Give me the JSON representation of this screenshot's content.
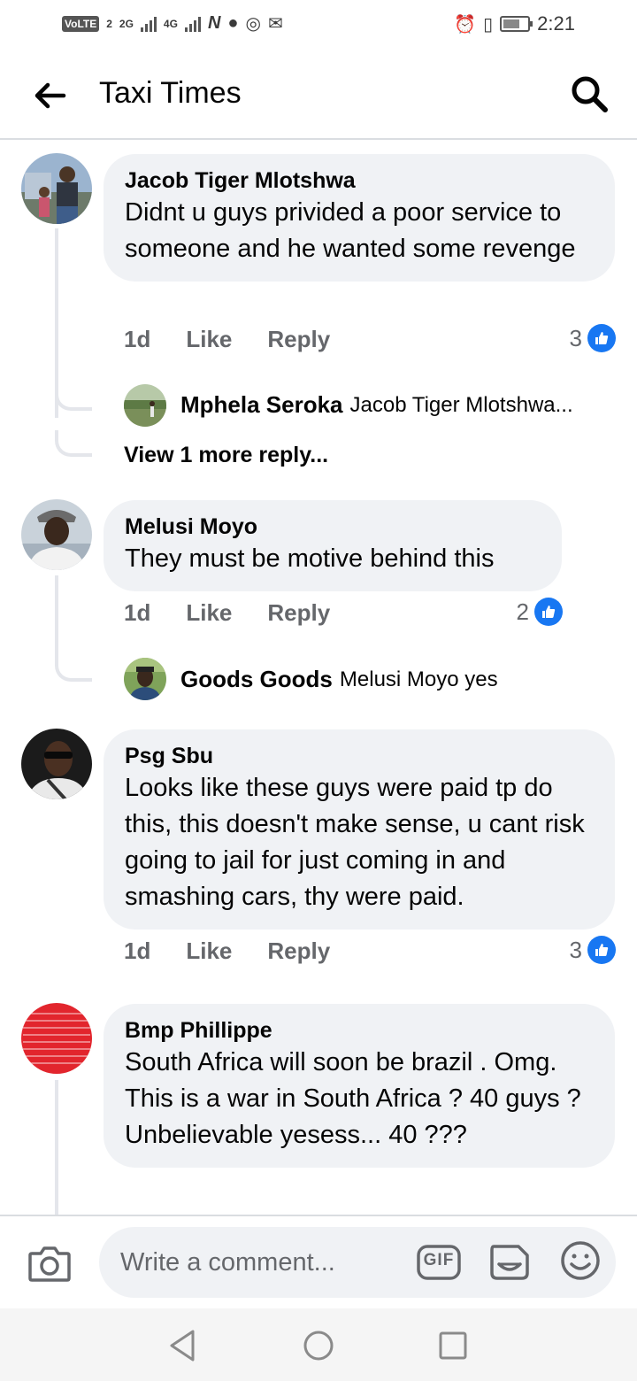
{
  "status_bar": {
    "network_badge": "VoLTE",
    "sim_number": "2",
    "sig1_label": "2G",
    "sig2_label": "4G",
    "time": "2:21"
  },
  "header": {
    "title": "Taxi Times"
  },
  "comments": [
    {
      "author": "Jacob Tiger Mlotshwa",
      "text": "Didnt u guys privided a poor service to someone and he wanted some revenge",
      "time": "1d",
      "like_label": "Like",
      "reply_label": "Reply",
      "reaction_count": "3",
      "reply_preview": {
        "author": "Mphela Seroka",
        "text": "Jacob Tiger Mlotshwa..."
      },
      "more_replies": "View 1 more reply..."
    },
    {
      "author": "Melusi Moyo",
      "text": "They must be motive behind this",
      "time": "1d",
      "like_label": "Like",
      "reply_label": "Reply",
      "reaction_count": "2",
      "reply_preview": {
        "author": "Goods Goods",
        "text": "Melusi Moyo yes"
      }
    },
    {
      "author": "Psg Sbu",
      "text": "Looks like these guys were paid tp do this, this doesn't make sense, u cant risk going to jail for just coming in and smashing cars, thy were paid.",
      "time": "1d",
      "like_label": "Like",
      "reply_label": "Reply",
      "reaction_count": "3"
    },
    {
      "author": "Bmp Phillippe",
      "text": "South Africa will soon be brazil . Omg. This is a war in South Africa ? 40 guys ? Unbelievable yesess... 40 ???"
    }
  ],
  "composer": {
    "placeholder": "Write a comment...",
    "gif_label": "GIF"
  },
  "colors": {
    "accent": "#1877f2",
    "bubble": "#f0f2f5",
    "muted_text": "#65676b",
    "divider": "#dadde1"
  }
}
